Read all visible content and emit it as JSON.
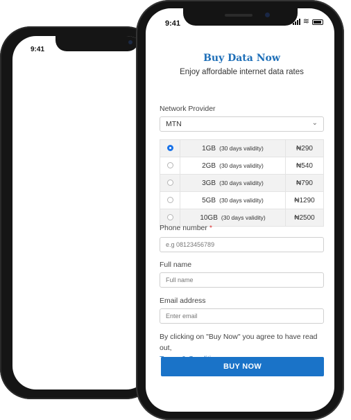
{
  "back_phone": {
    "time": "9:41"
  },
  "front_phone": {
    "time": "9:41"
  },
  "page": {
    "title": "Buy Data Now",
    "subtitle": "Enjoy affordable internet data rates"
  },
  "network": {
    "label": "Network Provider",
    "selected": "MTN"
  },
  "plans": [
    {
      "size": "1GB",
      "validity": "(30 days validity)",
      "price": "₦290",
      "selected": true
    },
    {
      "size": "2GB",
      "validity": "(30 days validity)",
      "price": "₦540",
      "selected": false
    },
    {
      "size": "3GB",
      "validity": "(30 days validity)",
      "price": "₦790",
      "selected": false
    },
    {
      "size": "5GB",
      "validity": "(30 days validity)",
      "price": "₦1290",
      "selected": false
    },
    {
      "size": "10GB",
      "validity": "(30 days validity)",
      "price": "₦2500",
      "selected": false
    }
  ],
  "phone": {
    "label": "Phone number",
    "required_mark": "*",
    "placeholder": "e.g 08123456789"
  },
  "fullname": {
    "label": "Full name",
    "placeholder": "Full name"
  },
  "email": {
    "label": "Email address",
    "placeholder": "Enter email"
  },
  "agreement": {
    "text": "By clicking on \"Buy Now\" you agree to have read out,",
    "link": "Terms & Condition"
  },
  "buy_button": "BUY NOW",
  "colors": {
    "accent": "#1a73c8",
    "title": "#1e6fb8",
    "phone_body": "#141414"
  }
}
